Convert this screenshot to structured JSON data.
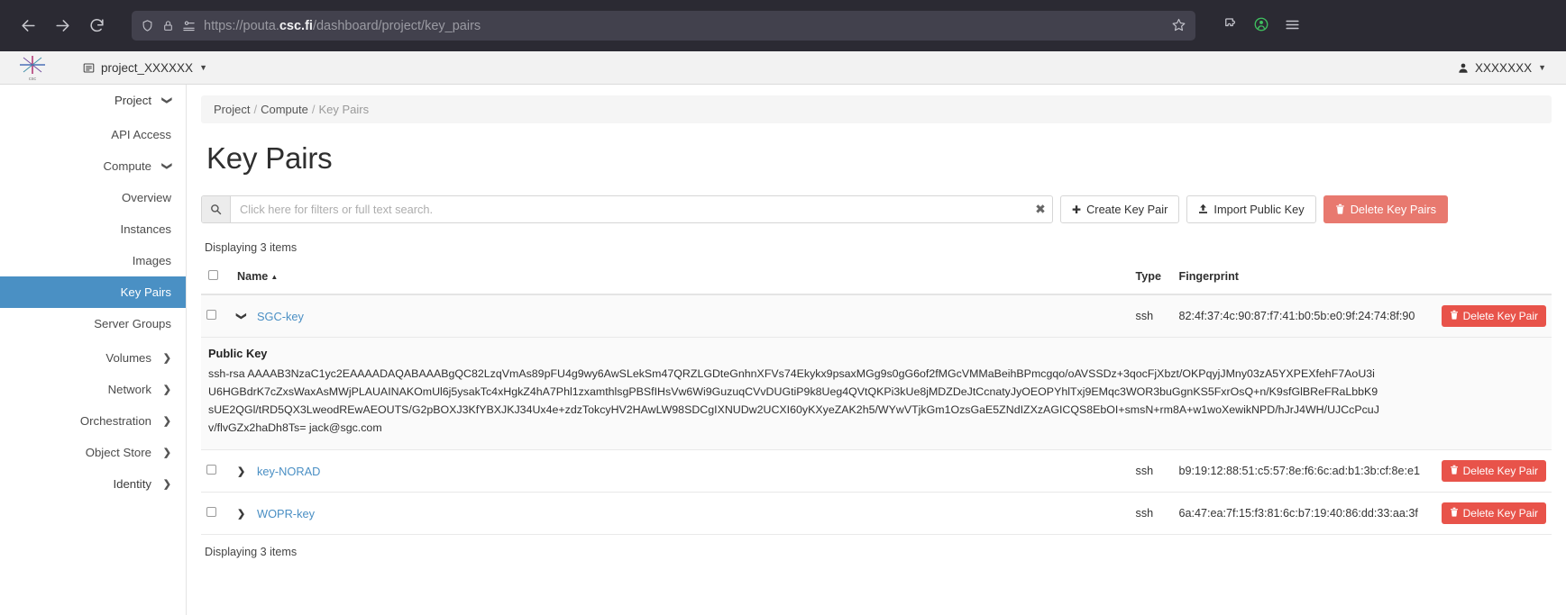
{
  "browser": {
    "back_label": "Back",
    "forward_label": "Forward",
    "reload_label": "Reload",
    "url_scheme": "https://",
    "url_domain_pre": "pouta.",
    "url_domain_bold": "csc.fi",
    "url_path": "/dashboard/project/key_pairs",
    "bookmark_label": "Bookmark this page",
    "extensions_label": "Extensions",
    "account_label": "Account",
    "menu_label": "Open application menu"
  },
  "topbar": {
    "logo_text": "csc",
    "project_name": "project_XXXXXX",
    "user_name": "XXXXXXX"
  },
  "sidebar": {
    "items": [
      {
        "label": "Project",
        "level": 0,
        "chev": "down",
        "active": false
      },
      {
        "label": "API Access",
        "level": 1,
        "chev": "",
        "active": false
      },
      {
        "label": "Compute",
        "level": 1,
        "chev": "down",
        "active": false
      },
      {
        "label": "Overview",
        "level": 2,
        "chev": "",
        "active": false
      },
      {
        "label": "Instances",
        "level": 2,
        "chev": "",
        "active": false
      },
      {
        "label": "Images",
        "level": 2,
        "chev": "",
        "active": false
      },
      {
        "label": "Key Pairs",
        "level": 2,
        "chev": "",
        "active": true
      },
      {
        "label": "Server Groups",
        "level": 2,
        "chev": "",
        "active": false
      },
      {
        "label": "Volumes",
        "level": 1,
        "chev": "right",
        "active": false
      },
      {
        "label": "Network",
        "level": 1,
        "chev": "right",
        "active": false
      },
      {
        "label": "Orchestration",
        "level": 1,
        "chev": "right",
        "active": false
      },
      {
        "label": "Object Store",
        "level": 1,
        "chev": "right",
        "active": false
      },
      {
        "label": "Identity",
        "level": 0,
        "chev": "right",
        "active": false
      }
    ]
  },
  "breadcrumb": {
    "items": [
      "Project",
      "Compute",
      "Key Pairs"
    ],
    "separator": "/"
  },
  "page": {
    "title": "Key Pairs",
    "count_top": "Displaying 3 items",
    "count_bottom": "Displaying 3 items"
  },
  "search": {
    "placeholder": "Click here for filters or full text search.",
    "value": "",
    "clear_glyph": "✖",
    "icon": "search-icon"
  },
  "toolbar": {
    "create_label": "Create Key Pair",
    "create_glyph": "✚",
    "import_label": "Import Public Key",
    "import_glyph": "⤒",
    "delete_label": "Delete Key Pairs",
    "delete_glyph": "🗑"
  },
  "table": {
    "headers": {
      "name": "Name",
      "type": "Type",
      "fingerprint": "Fingerprint",
      "sort_caret": "▲"
    },
    "row_action_label": "Delete Key Pair",
    "row_action_glyph": "🗑",
    "rows": [
      {
        "name": "SGC-key",
        "type": "ssh",
        "fingerprint": "82:4f:37:4c:90:87:f7:41:b0:5b:e0:9f:24:74:8f:90",
        "expanded": true,
        "public_key_label": "Public Key",
        "public_key": "ssh-rsa AAAAB3NzaC1yc2EAAAADAQABAAABgQC82LzqVmAs89pFU4g9wy6AwSLekSm47QRZLGDteGnhnXFVs74Ekykx9psaxMGg9s0gG6of2fMGcVMMaBeihBPmcgqo/oAVSSDz+3qocFjXbzt/OKPqyjJMny03zA5YXPEXfehF7AoU3iU6HGBdrK7cZxsWaxAsMWjPLAUAINAKOmUl6j5ysakTc4xHgkZ4hA7Phl1zxamthlsgPBSfIHsVw6Wi9GuzuqCVvDUGtiP9k8Ueg4QVtQKPi3kUe8jMDZDeJtCcnatyJyOEOPYhlTxj9EMqc3WOR3buGgnKS5FxrOsQ+n/K9sfGlBReFRaLbbK9sUE2QGl/tRD5QX3LweodREwAEOUTS/G2pBOXJ3KfYBXJKJ34Ux4e+zdzTokcyHV2HAwLW98SDCgIXNUDw2UCXI60yKXyeZAK2h5/WYwVTjkGm1OzsGaE5ZNdIZXzAGICQS8EbOI+smsN+rm8A+w1woXewikNPD/hJrJ4WH/UJCcPcuJv/flvGZx2haDh8Ts= jack@sgc.com"
      },
      {
        "name": "key-NORAD",
        "type": "ssh",
        "fingerprint": "b9:19:12:88:51:c5:57:8e:f6:6c:ad:b1:3b:cf:8e:e1",
        "expanded": false
      },
      {
        "name": "WOPR-key",
        "type": "ssh",
        "fingerprint": "6a:47:ea:7f:15:f3:81:6c:b7:19:40:86:dd:33:aa:3f",
        "expanded": false
      }
    ]
  },
  "colors": {
    "accent": "#4a90c4",
    "danger": "#e8534a",
    "danger_soft": "#e8796f",
    "chrome": "#2b2a33",
    "link": "#4a8fc4"
  }
}
